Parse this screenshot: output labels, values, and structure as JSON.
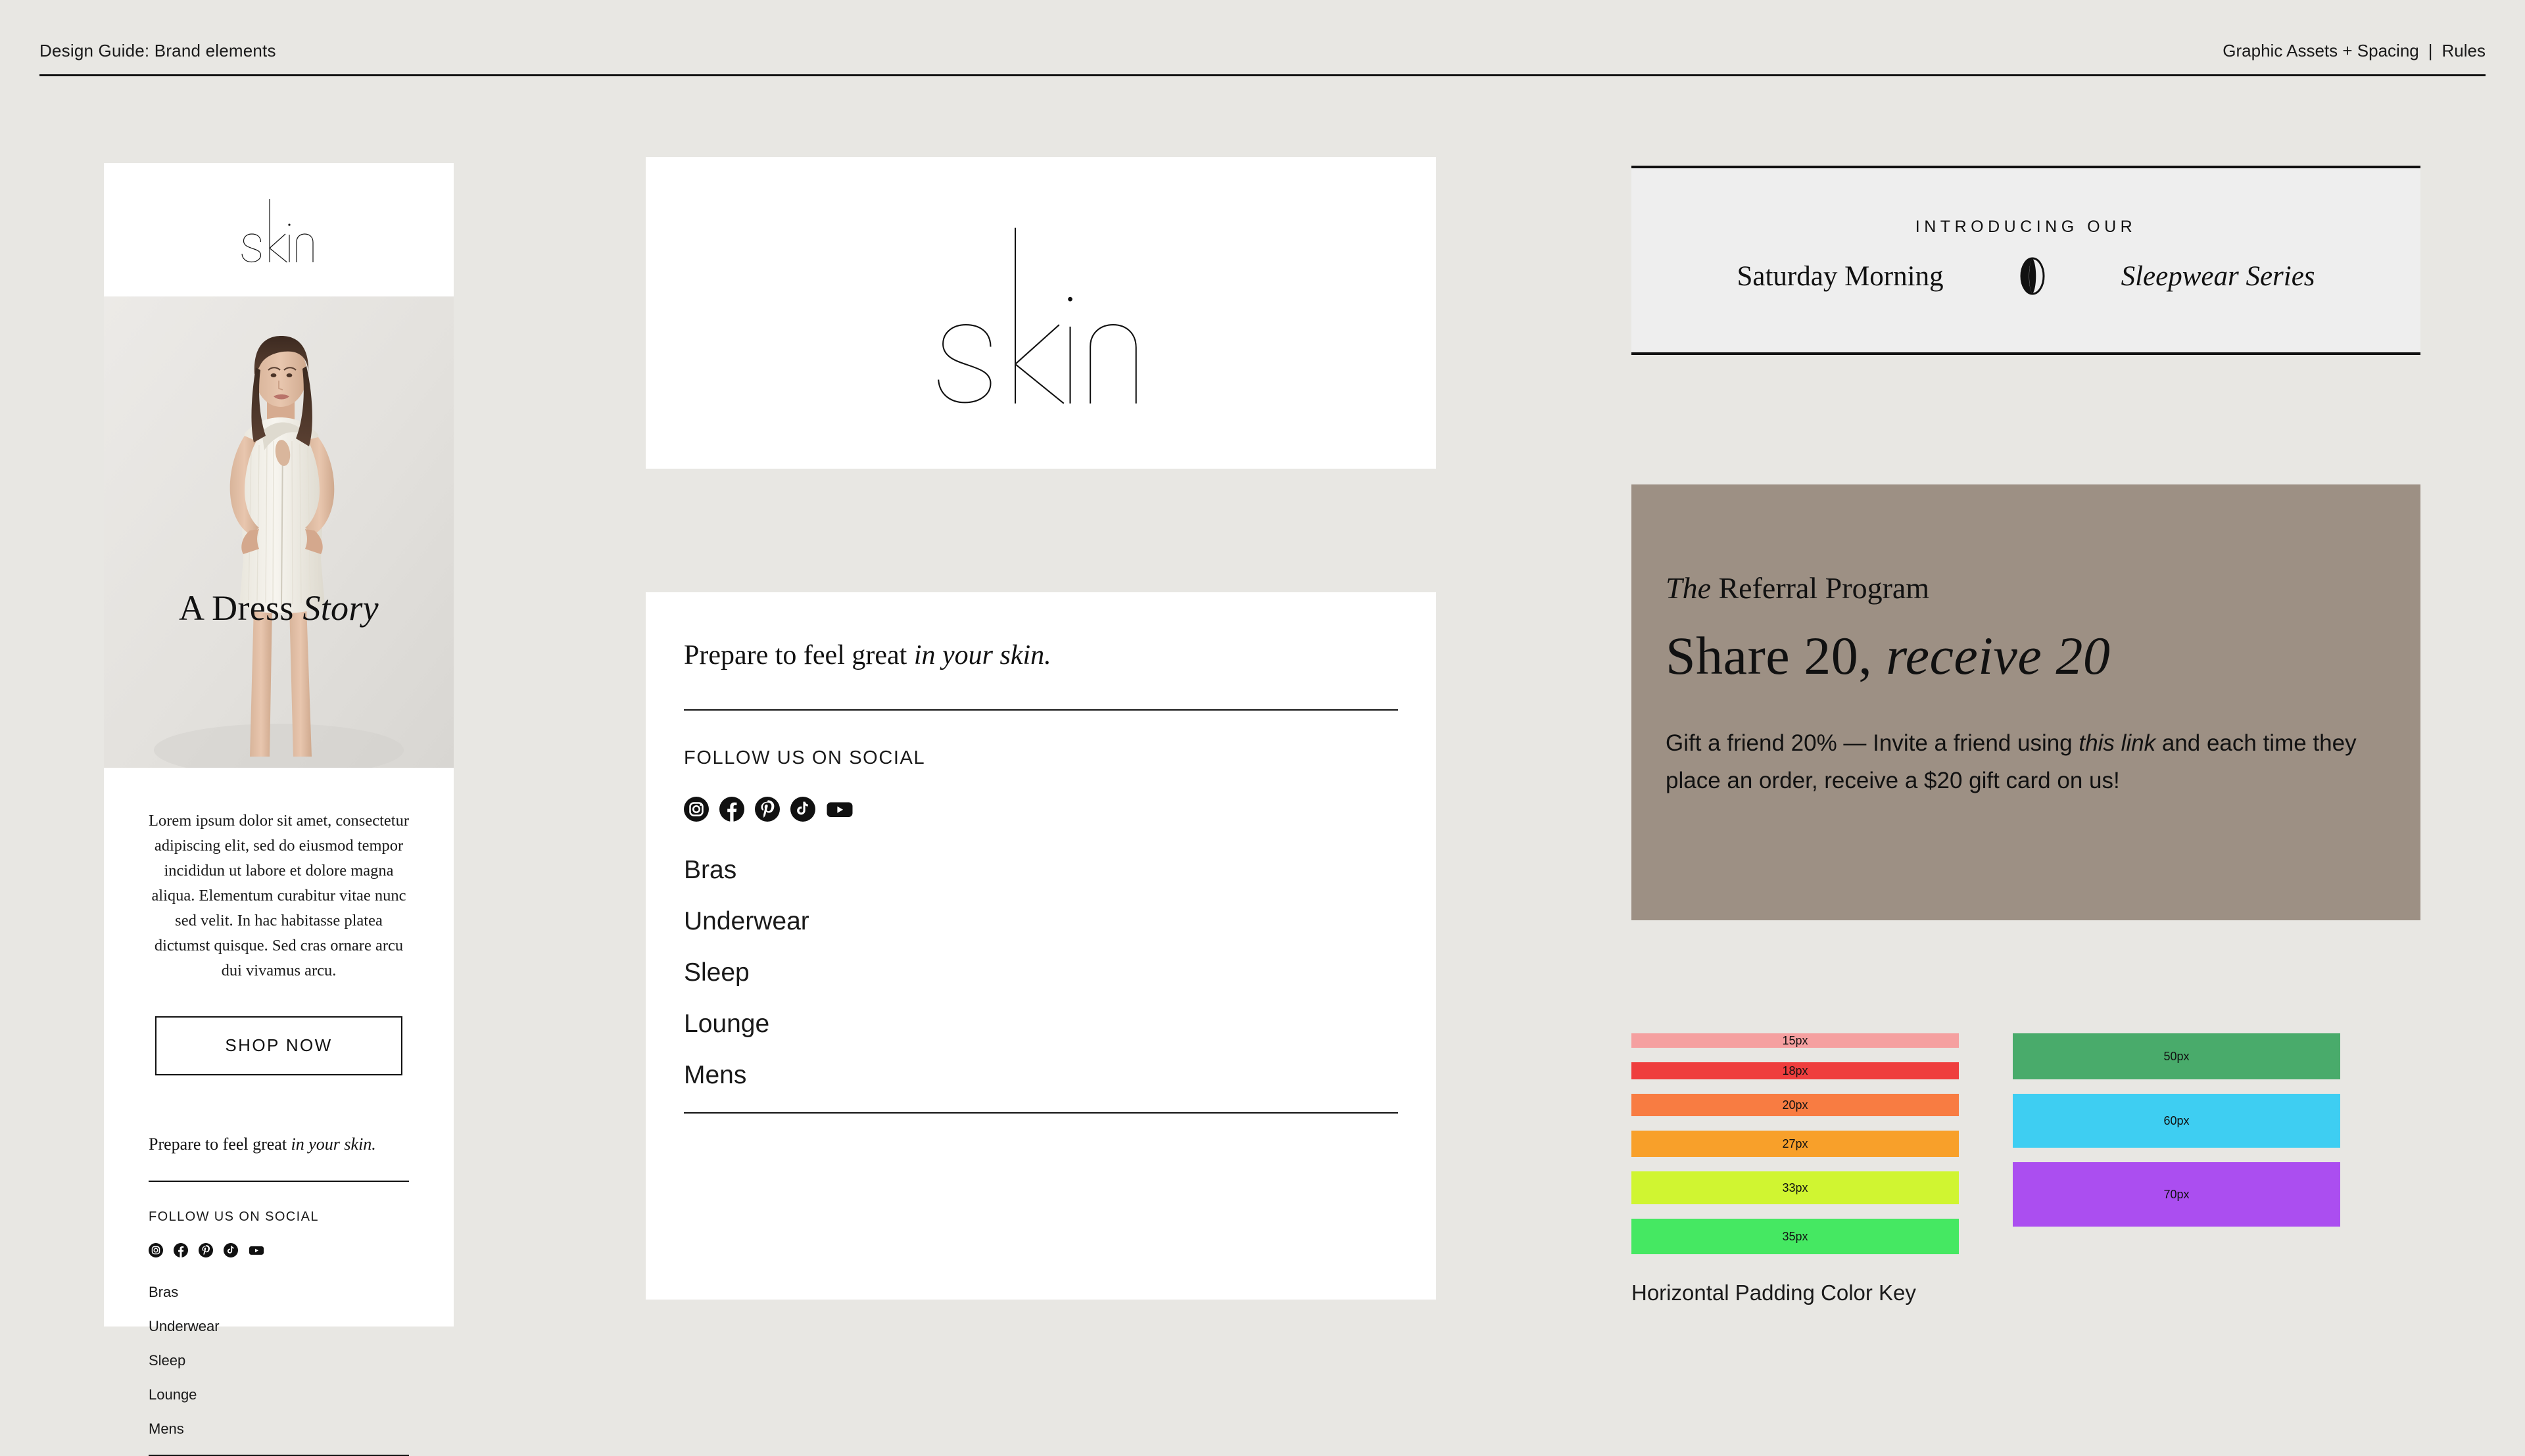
{
  "header": {
    "title": "Design Guide: Brand elements",
    "right_label": "Graphic Assets + Spacing",
    "separator": "|",
    "right_label_2": "Rules"
  },
  "brand": {
    "wordmark": "skin"
  },
  "email_mock": {
    "hero_caption_plain": "A Dress ",
    "hero_caption_italic": "Story",
    "body_copy": "Lorem ipsum dolor sit amet, consectetur adipiscing elit, sed do eiusmod tempor incididun ut labore et dolore magna aliqua. Elementum curabitur vitae nunc sed velit. In hac habitasse platea dictumst quisque. Sed cras ornare arcu dui vivamus arcu.",
    "cta_label": "SHOP NOW",
    "tagline_plain": "Prepare to feel great ",
    "tagline_italic": "in your skin.",
    "social_label": "FOLLOW US ON SOCIAL",
    "social_icons": [
      "instagram-icon",
      "facebook-icon",
      "pinterest-icon",
      "tiktok-icon",
      "youtube-icon"
    ],
    "nav_items": [
      "Bras",
      "Underwear",
      "Sleep",
      "Lounge",
      "Mens"
    ]
  },
  "components": {
    "tagline_plain": "Prepare to feel great ",
    "tagline_italic": "in your skin.",
    "social_label": "FOLLOW US ON SOCIAL",
    "social_icons": [
      "instagram-icon",
      "facebook-icon",
      "pinterest-icon",
      "tiktok-icon",
      "youtube-icon"
    ],
    "nav_items": [
      "Bras",
      "Underwear",
      "Sleep",
      "Lounge",
      "Mens"
    ]
  },
  "announcement": {
    "kicker": "INTRODUCING OUR",
    "left_text": "Saturday Morning",
    "icon": "moon-icon",
    "right_text": "Sleepwear Series"
  },
  "referral": {
    "eyebrow_italic": "The",
    "eyebrow_rest": " Referral Program",
    "headline_plain": "Share 20, ",
    "headline_italic": "receive 20",
    "body_part1": "Gift a friend 20% — Invite a friend using ",
    "body_italic": "this link",
    "body_part2": " and each time they place an order, receive a $20 gift card on us!",
    "background_color": "#9d9084"
  },
  "color_key": {
    "caption": "Horizontal Padding Color Key",
    "left_column": [
      {
        "label": "15px",
        "color": "#f5a0a0",
        "height": 22
      },
      {
        "label": "18px",
        "color": "#ef3e3e",
        "height": 26
      },
      {
        "label": "20px",
        "color": "#f87c42",
        "height": 34
      },
      {
        "label": "27px",
        "color": "#f8a02a",
        "height": 40
      },
      {
        "label": "33px",
        "color": "#d0f531",
        "height": 50
      },
      {
        "label": "35px",
        "color": "#45e862",
        "height": 54
      }
    ],
    "right_column": [
      {
        "label": "50px",
        "color": "#49ab6b",
        "height": 70
      },
      {
        "label": "60px",
        "color": "#3ecef2",
        "height": 82
      },
      {
        "label": "70px",
        "color": "#ab4ef0",
        "height": 98
      }
    ]
  }
}
